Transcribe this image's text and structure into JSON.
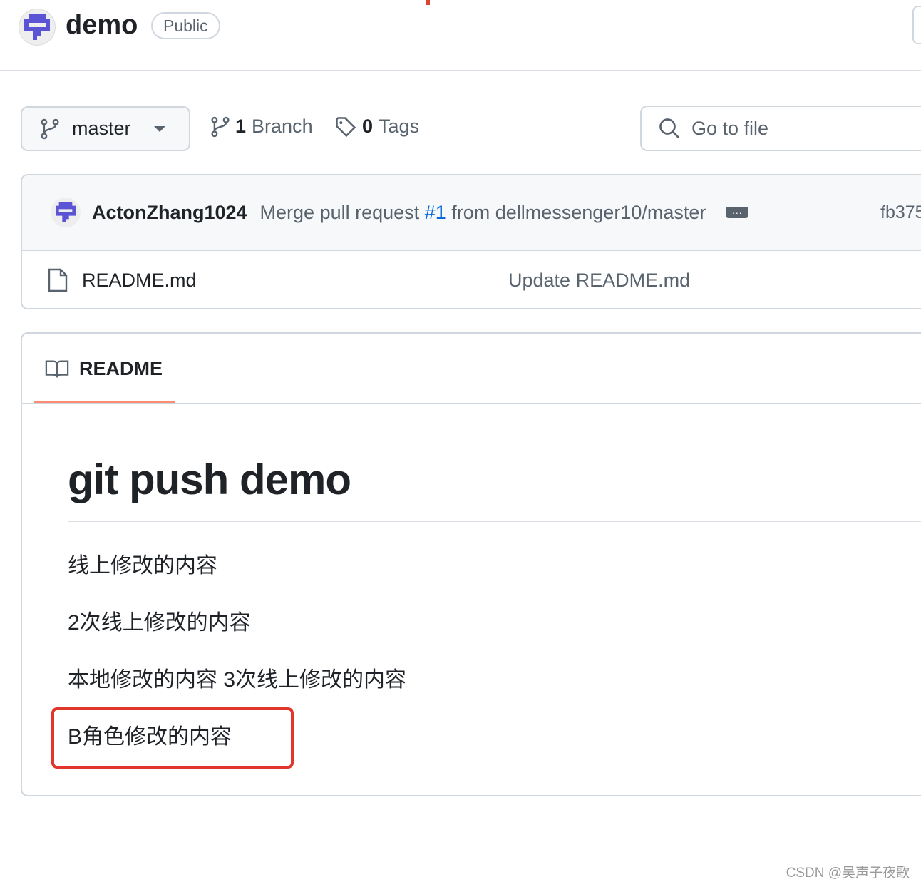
{
  "repo": {
    "name": "demo",
    "visibility": "Public"
  },
  "toolbar": {
    "branch": "master",
    "branch_count": "1",
    "branch_label": "Branch",
    "tag_count": "0",
    "tag_label": "Tags",
    "go_to_file": "Go to file"
  },
  "commit": {
    "author": "ActonZhang1024",
    "message_prefix": "Merge pull request ",
    "pr_link": "#1",
    "message_suffix": " from dellmessenger10/master",
    "sha": "fb375"
  },
  "files": [
    {
      "name": "README.md",
      "commit_message": "Update README.md"
    }
  ],
  "readme": {
    "tab": "README",
    "heading": "git push demo",
    "paragraphs": [
      "线上修改的内容",
      "2次线上修改的内容",
      "本地修改的内容 3次线上修改的内容",
      "B角色修改的内容"
    ]
  },
  "watermark": "CSDN @吴声子夜歌",
  "colors": {
    "link": "#0969da",
    "tab_underline": "#fd8c73",
    "highlight_box": "#e0362b",
    "avatar": "#5b55d6"
  }
}
